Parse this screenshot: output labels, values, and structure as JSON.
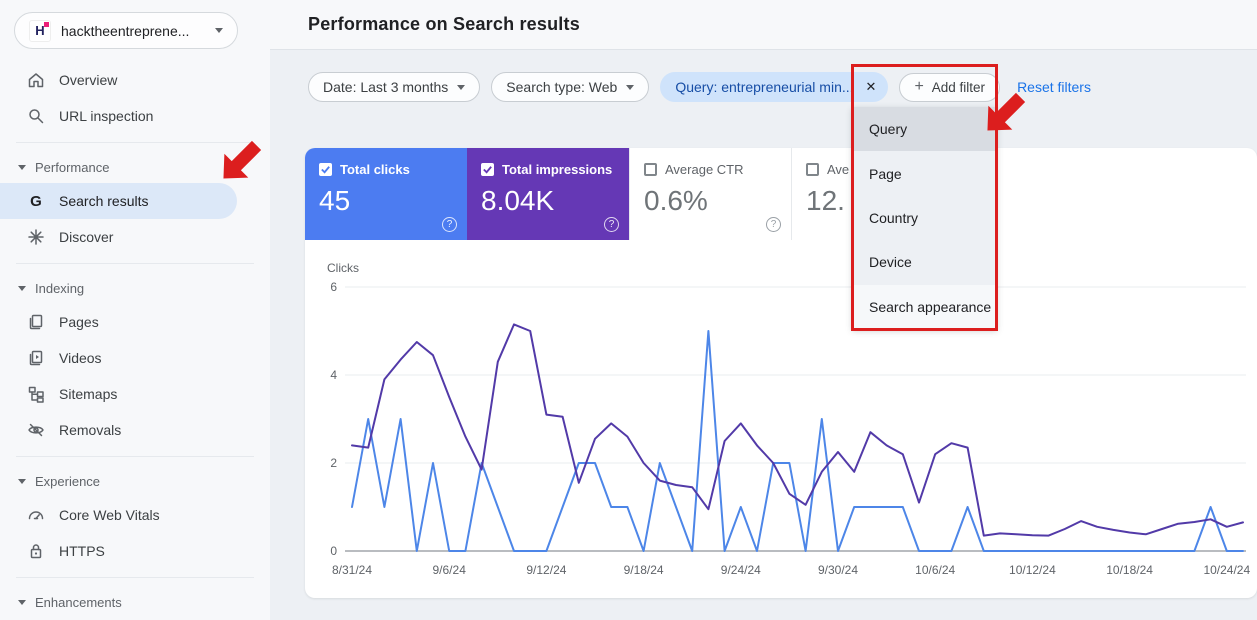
{
  "app": {
    "property_name": "hacktheentreprene...",
    "logo_letter": "H"
  },
  "sidebar": {
    "nav": [
      {
        "label": "Overview"
      },
      {
        "label": "URL inspection"
      },
      {
        "label": "Performance"
      },
      {
        "label": "Search results"
      },
      {
        "label": "Discover"
      },
      {
        "label": "Indexing"
      },
      {
        "label": "Pages"
      },
      {
        "label": "Videos"
      },
      {
        "label": "Sitemaps"
      },
      {
        "label": "Removals"
      },
      {
        "label": "Experience"
      },
      {
        "label": "Core Web Vitals"
      },
      {
        "label": "HTTPS"
      },
      {
        "label": "Enhancements"
      }
    ],
    "selected_item": "Search results"
  },
  "header": {
    "title": "Performance on Search results"
  },
  "filters": {
    "date_chip": "Date: Last 3 months",
    "search_type_chip": "Search type: Web",
    "query_chip": "Query: entrepreneurial min...",
    "query_chip_close": "✕",
    "add_filter": "Add filter",
    "reset_filters": "Reset filters"
  },
  "metrics": [
    {
      "label": "Total clicks",
      "value": "45",
      "checked": true
    },
    {
      "label": "Total impressions",
      "value": "8.04K",
      "checked": true
    },
    {
      "label": "Average CTR",
      "value": "0.6%",
      "checked": false
    },
    {
      "label": "Ave",
      "value": "12.",
      "checked": false
    }
  ],
  "dropdown": {
    "items": [
      "Query",
      "Page",
      "Country",
      "Device",
      "Search appearance"
    ],
    "highlighted": "Query"
  },
  "chart_data": {
    "type": "line",
    "ylabel": "Clicks",
    "yticks": [
      0,
      2,
      4,
      6
    ],
    "ylim": [
      0,
      6
    ],
    "grid": true,
    "x_start": "8/31/24",
    "x_interval_days": 1,
    "x_tick_labels": [
      "8/31/24",
      "9/6/24",
      "9/12/24",
      "9/18/24",
      "9/24/24",
      "9/30/24",
      "10/6/24",
      "10/12/24",
      "10/18/24",
      "10/24/24"
    ],
    "series": [
      {
        "name": "Total clicks",
        "color": "#4d86e8",
        "values": [
          1,
          3,
          1,
          3,
          0,
          2,
          0,
          0,
          2,
          1,
          0,
          0,
          0,
          1,
          2,
          2,
          1,
          1,
          0,
          2,
          1,
          0,
          5,
          0,
          1,
          0,
          2,
          2,
          0,
          3,
          0,
          1,
          1,
          1,
          1,
          0,
          0,
          0,
          1,
          0,
          0,
          0,
          0,
          0,
          0,
          0,
          0,
          0,
          0,
          0,
          0,
          0,
          0,
          1,
          0,
          0
        ]
      },
      {
        "name": "Total impressions (plotted on hidden scaled axis)",
        "color": "#523aa8",
        "values": [
          2.4,
          2.35,
          3.9,
          4.35,
          4.75,
          4.45,
          3.5,
          2.6,
          1.85,
          4.3,
          5.15,
          5.0,
          3.1,
          3.05,
          1.55,
          2.55,
          2.9,
          2.6,
          2.0,
          1.6,
          1.5,
          1.45,
          0.95,
          2.5,
          2.9,
          2.4,
          2.0,
          1.3,
          1.05,
          1.8,
          2.25,
          1.8,
          2.7,
          2.4,
          2.2,
          1.1,
          2.2,
          2.45,
          2.35,
          0.35,
          0.4,
          0.38,
          0.36,
          0.35,
          0.5,
          0.68,
          0.55,
          0.48,
          0.42,
          0.38,
          0.5,
          0.62,
          0.66,
          0.72,
          0.55,
          0.65
        ]
      }
    ]
  },
  "colors": {
    "clicks_card_blue": "#4c7cf1",
    "impressions_card_purple": "#6538b5",
    "clicks_line": "#4d86e8",
    "impressions_line": "#523aa8",
    "selected_nav_pill": "#dce8f8",
    "query_chip_bg": "#cfe3fb",
    "link_blue": "#1a73e8",
    "annotation_red": "#dc1e1e"
  }
}
